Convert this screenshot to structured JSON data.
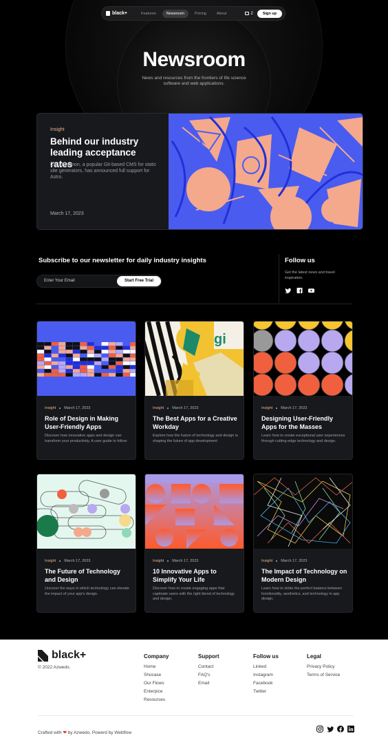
{
  "nav": {
    "brand": "black+",
    "links": [
      "Features",
      "Newsroom",
      "Pricing",
      "About"
    ],
    "active": "Newsroom",
    "cart_count": "2",
    "signup": "Sign up"
  },
  "hero": {
    "title": "Newsroom",
    "subtitle": "News and resources from the frontiers of life science software and web applications."
  },
  "featured": {
    "tag": "Insight",
    "title": "Behind our industry leading acceptance rates",
    "description": "CloudCannon, a popular Git-based CMS for static site generators, has announced full support for Astro.",
    "date": "March 17, 2023"
  },
  "newsletter": {
    "title": "Subscribe to our newsletter for daily industry insights",
    "placeholder": "Enter Your Email",
    "button": "Start Free Trial"
  },
  "follow": {
    "title": "Follow us",
    "text": "Get the latest news and travel inspiration.",
    "icons": [
      "twitter-icon",
      "facebook-icon",
      "youtube-icon"
    ]
  },
  "cards": [
    {
      "tag": "Insight",
      "date": "March 17, 2023",
      "title": "Role of Design in Making User-Friendly Apps",
      "desc": " Discover how innovative apps and design can transform your productivity. A user guide to follow"
    },
    {
      "tag": "Insight",
      "date": "March 17, 2023",
      "title": "The Best Apps for a Creative Workday",
      "desc": "Explore how the fusion of technology and design is shaping the future of app development"
    },
    {
      "tag": "Insight",
      "date": "March 17, 2023",
      "title": "Designing User-Friendly Apps for the Masses",
      "desc": "Learn how to create exceptional user experiences through cutting-edge technology and design."
    },
    {
      "tag": "Insight",
      "date": "March 17, 2023",
      "title": "The Future of Technology and Design",
      "desc": "Uncover the ways in which technology can elevate the impact of your app's design."
    },
    {
      "tag": "Insight",
      "date": "March 17, 2023",
      "title": "10 Innovative Apps to Simplify Your Life",
      "desc": "Discover how to create engaging apps that captivate users with the right blend of technology and design."
    },
    {
      "tag": "Insight",
      "date": "March 17, 2023",
      "title": "The Impact of Technology on Modern Design",
      "desc": "Learn how to strike the perfect balance between functionality, aesthetics, and technology in app design."
    }
  ],
  "footer": {
    "brand": "black+",
    "copyright": "© 2022 Azwedo.",
    "columns": [
      {
        "heading": "Company",
        "links": [
          "Home",
          "Shocase",
          "Our Flows",
          "Enterpice",
          "Resourses"
        ]
      },
      {
        "heading": "Support",
        "links": [
          "Contact",
          "FAQ's",
          "Email"
        ]
      },
      {
        "heading": "Follow us",
        "links": [
          "Linked",
          "Instagram",
          "Facebook",
          "Twitter"
        ]
      },
      {
        "heading": "Legal",
        "links": [
          "Privacy Policy",
          "Terms of Service"
        ]
      }
    ],
    "credit_prefix": "Crafted with",
    "credit_suffix": "by Azwedo, Powerd by Webflow",
    "social": [
      "instagram-icon",
      "twitter-icon",
      "facebook-icon",
      "linkedin-icon"
    ]
  },
  "colors": {
    "accent": "#e8b493",
    "card_bg": "#17191d",
    "featured_blue": "#4a5cf0",
    "featured_peach": "#f4a98c"
  }
}
